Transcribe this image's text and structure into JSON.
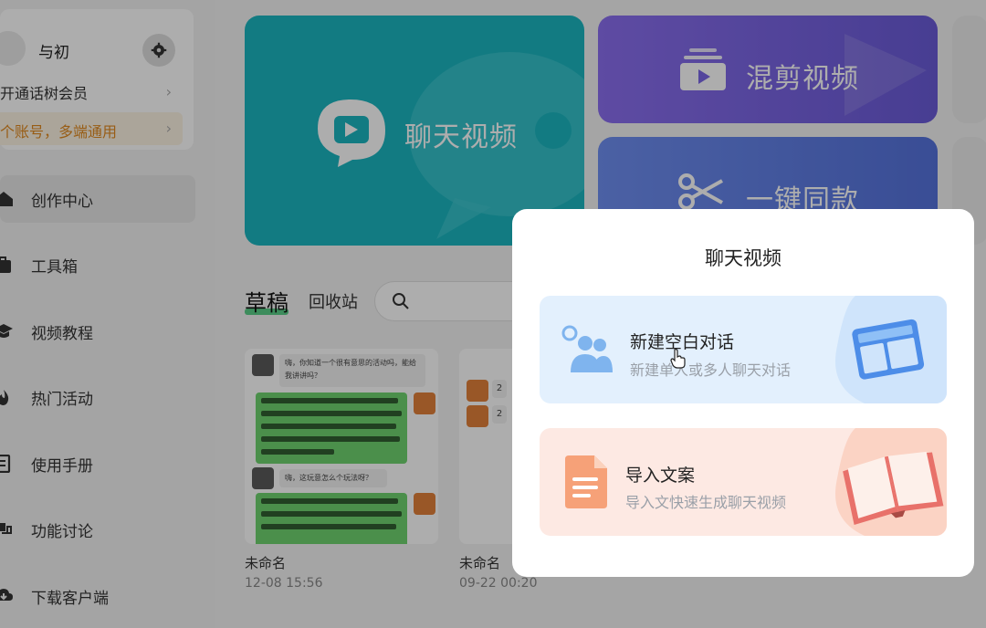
{
  "sidebar": {
    "user_name": "与初",
    "promo_vip": "开通话树会员",
    "promo_multi": "个账号，多端通用",
    "nav": [
      {
        "label": "创作中心",
        "active": true
      },
      {
        "label": "工具箱"
      },
      {
        "label": "视频教程"
      },
      {
        "label": "热门活动"
      },
      {
        "label": "使用手册"
      },
      {
        "label": "功能讨论"
      },
      {
        "label": "下载客户端"
      }
    ]
  },
  "main": {
    "cards": {
      "chat": "聊天视频",
      "mix": "混剪视频",
      "sync": "一键同款"
    },
    "tabs": {
      "draft": "草稿",
      "recycle": "回收站"
    },
    "drafts": [
      {
        "name": "未命名",
        "time": "12-08 15:56"
      },
      {
        "name": "未命名",
        "time": "09-22 00:20"
      }
    ],
    "preview": {
      "q1": "嗨，你知道一个很有意思的活动吗，能给我讲讲吗？",
      "q2": "嗨，这玩意怎么个玩法呀？",
      "badge1": "2",
      "badge2": "2"
    }
  },
  "modal": {
    "title": "聊天视频",
    "blank": {
      "title": "新建空白对话",
      "desc": "新建单人或多人聊天对话"
    },
    "import": {
      "title": "导入文案",
      "desc": "导入文快速生成聊天视频"
    }
  },
  "colors": {
    "chat_card": "#1bb5c0",
    "mix_card": "#7b66e6",
    "sync_card": "#6281e8",
    "promo": "#e08a1f",
    "draft_tab": "#34c46d",
    "blank_option_bg": "#e3f0fd",
    "import_option_bg": "#fde9e3"
  }
}
